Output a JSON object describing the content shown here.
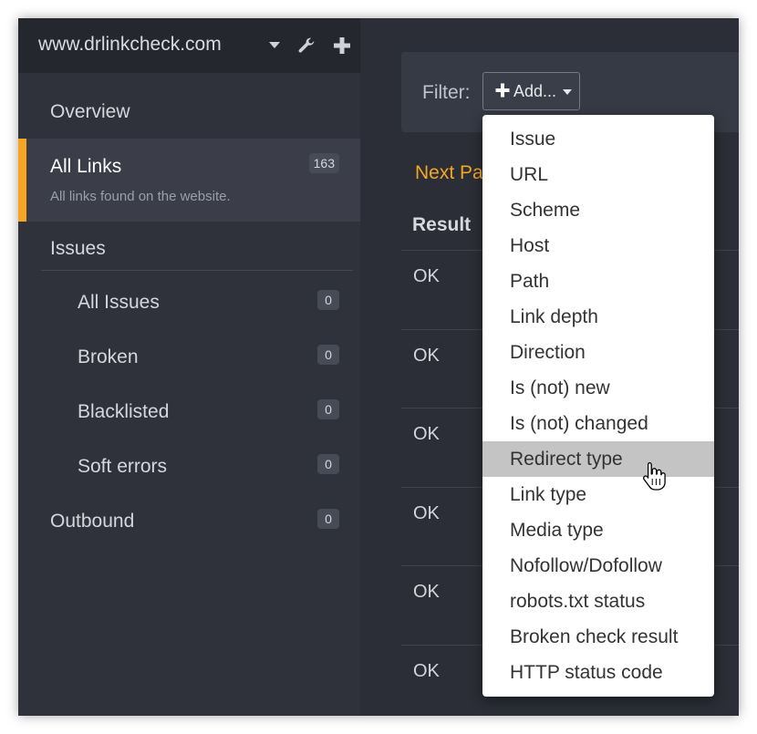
{
  "sidebar": {
    "site": "www.drlinkcheck.com",
    "items": [
      {
        "label": "Overview"
      },
      {
        "label": "All Links",
        "count": "163",
        "subtitle": "All links found on the website."
      },
      {
        "label": "Issues"
      },
      {
        "label": "All Issues",
        "count": "0"
      },
      {
        "label": "Broken",
        "count": "0"
      },
      {
        "label": "Blacklisted",
        "count": "0"
      },
      {
        "label": "Soft errors",
        "count": "0"
      },
      {
        "label": "Outbound",
        "count": "0"
      }
    ]
  },
  "filter": {
    "label": "Filter:",
    "add_button": "Add..."
  },
  "main": {
    "next_page": "Next Pa",
    "result_header": "Result",
    "rows": [
      "OK",
      "OK",
      "OK",
      "OK",
      "OK",
      "OK"
    ]
  },
  "dropdown": {
    "items": [
      "Issue",
      "URL",
      "Scheme",
      "Host",
      "Path",
      "Link depth",
      "Direction",
      "Is (not) new",
      "Is (not) changed",
      "Redirect type",
      "Link type",
      "Media type",
      "Nofollow/Dofollow",
      "robots.txt status",
      "Broken check result",
      "HTTP status code"
    ],
    "highlighted": "Redirect type"
  },
  "colors": {
    "accent": "#f5a623",
    "sidebar_bg": "#2f323b",
    "main_bg": "#2b2e36"
  },
  "icons": [
    "wrench-icon",
    "plus-icon",
    "chevron-down-icon",
    "hand-cursor-icon"
  ]
}
